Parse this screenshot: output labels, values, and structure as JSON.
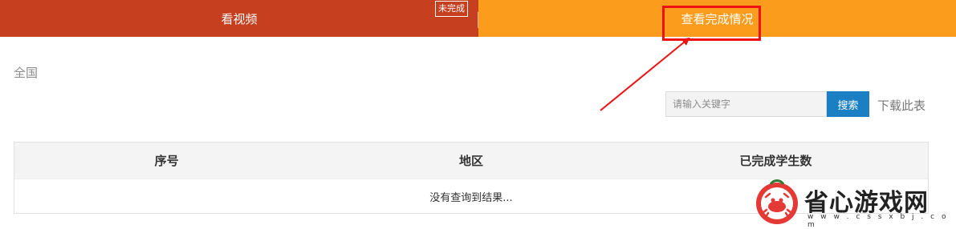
{
  "tabs": [
    {
      "label": "看视频",
      "badge": "未完成"
    },
    {
      "label": "查看完成情况"
    }
  ],
  "region": "全国",
  "search": {
    "placeholder": "请输入关键字",
    "button": "搜索",
    "download": "下载此表"
  },
  "table": {
    "columns": [
      "序号",
      "地区",
      "已完成学生数"
    ],
    "empty_message": "没有查询到结果..."
  },
  "watermark": {
    "text": "省心游戏网",
    "url": "w w w . c s s x b j . c o m"
  },
  "colors": {
    "tab_video": "#c63f1f",
    "tab_status": "#fb9c1d",
    "search_button": "#1a80c3",
    "annotation": "#ee1111"
  }
}
